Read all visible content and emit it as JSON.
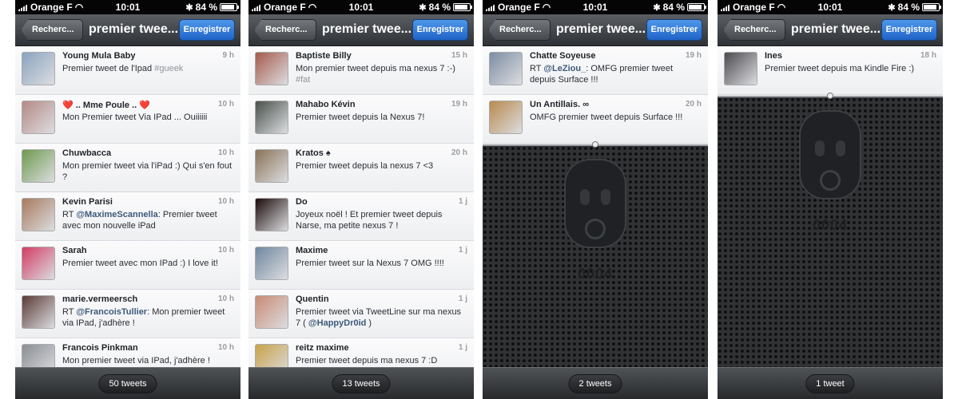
{
  "statusbar": {
    "carrier": "Orange F",
    "time": "10:01",
    "battery": "84 %"
  },
  "navbar": {
    "back_label": "Recherc...",
    "title": "premier twee...",
    "save_label": "Enregistrer"
  },
  "colors": {
    "accent": "#2f7ad8",
    "mention": "#3c5a7a",
    "heart": "#d01c2a"
  },
  "panels": [
    {
      "count_label": "50 tweets",
      "tweets": [
        {
          "name": "Young Mula Baby",
          "time": "9 h",
          "text": "Premier tweet de l'Ipad ",
          "hashtag": "#gueek",
          "avatar_color": "#8aa3bf"
        },
        {
          "prefix": "❤️ ",
          "name": ".. Mme Poule ..",
          "suffix": " ❤️",
          "time": "10 h",
          "text": "Mon Premier tweet Via IPad ... Ouiiiiii",
          "avatar_color": "#b58a86"
        },
        {
          "name": "Chuwbacca",
          "time": "10 h",
          "text": "Mon premier tweet via l'iPad :) Qui s'en fout ?",
          "avatar_color": "#6e9a4e"
        },
        {
          "name": "Kevin Parisi",
          "time": "10 h",
          "rt": "RT ",
          "mention": "@MaximeScannella",
          "text": ": Premier tweet avec mon nouvelle iPad",
          "avatar_color": "#a87a5e"
        },
        {
          "name": "Sarah",
          "time": "10 h",
          "text": "Premier tweet avec mon IPad :) I love it!",
          "avatar_color": "#d23c64"
        },
        {
          "name": "marie.vermeersch",
          "time": "10 h",
          "rt": "RT ",
          "mention": "@FrancoisTullier",
          "text": ": Mon premier tweet via IPad, j'adhère !",
          "avatar_color": "#5a3a36"
        },
        {
          "name": "Francois Pinkman",
          "time": "10 h",
          "text": "Mon premier tweet via IPad, j'adhère !",
          "avatar_color": "#8b8f95"
        }
      ]
    },
    {
      "count_label": "13 tweets",
      "tweets": [
        {
          "name": "Baptiste Billy",
          "time": "15 h",
          "text": "Mon premier tweet depuis ma nexus 7 :-) ",
          "hashtag": "#fat",
          "avatar_color": "#a55a4c"
        },
        {
          "name": "Mahabo Kévin",
          "time": "19 h",
          "text": "Premier tweet depuis la Nexus 7!",
          "avatar_color": "#49504b"
        },
        {
          "name": "Kratos",
          "suffix": " ♠",
          "time": "20 h",
          "text": "Premier tweet depuis la nexus 7 <3",
          "avatar_color": "#8a7258"
        },
        {
          "name": "Do",
          "time": "1 j",
          "text": "Joyeux noël ! Et premier tweet depuis Narse, ma petite nexus 7 !",
          "avatar_color": "#1a0a0a"
        },
        {
          "name": "Maxime",
          "time": "1 j",
          "text": "Premier tweet sur la Nexus 7 OMG !!!!",
          "avatar_color": "#6f86a0"
        },
        {
          "name": "Quentin",
          "time": "1 j",
          "text": "Premier tweet via TweetLine sur ma nexus 7 ( ",
          "mention": "@HappyDr0id",
          "text_after": " )",
          "avatar_color": "#c98a74"
        },
        {
          "name": "reitz maxime",
          "time": "1 j",
          "text": "Premier tweet depuis ma nexus 7 :D",
          "avatar_color": "#c9a24a"
        }
      ]
    },
    {
      "count_label": "2 tweets",
      "robot_counter": "0004",
      "tweets": [
        {
          "name": "Chatte Soyeuse",
          "time": "19 h",
          "rt": "RT ",
          "mention": "@LeZiou_",
          "text": ": OMFG premier tweet depuis Surface !!!",
          "avatar_color": "#7d8da3"
        },
        {
          "name": "Un Antillais. ∞",
          "time": "20 h",
          "text": "OMFG premier tweet depuis Surface !!!",
          "avatar_color": "#b98a4f"
        }
      ]
    },
    {
      "count_label": "1 tweet",
      "robot_counter": "0004",
      "tweets": [
        {
          "name": "Ines",
          "time": "18 h",
          "text": "Premier tweet depuis ma Kindle Fire :)",
          "avatar_color": "#4b4a4e"
        }
      ]
    }
  ]
}
